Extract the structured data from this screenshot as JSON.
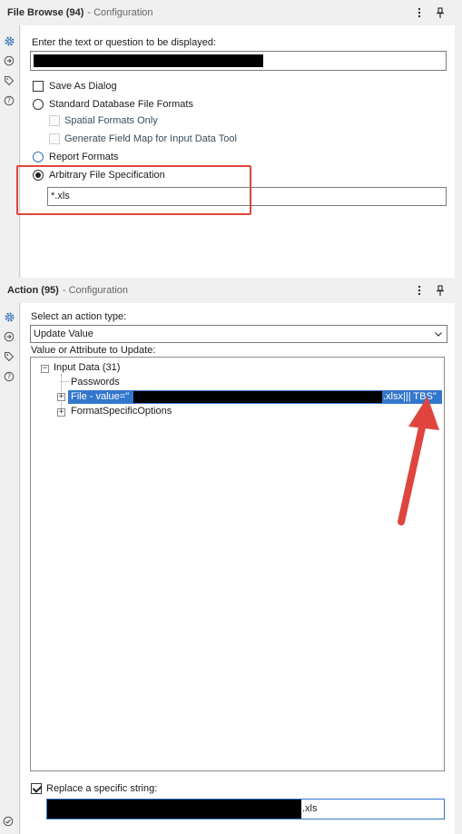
{
  "file_browse": {
    "title": "File Browse (94)",
    "subtitle": "- Configuration",
    "prompt_label": "Enter the text or question to be displayed:",
    "save_as_dialog": "Save As Dialog",
    "standard_formats": "Standard Database File Formats",
    "spatial_only": "Spatial Formats Only",
    "generate_field_map": "Generate Field Map for Input Data Tool",
    "report_formats": "Report Formats",
    "arbitrary_spec": "Arbitrary File Specification",
    "spec_value": "*.xls"
  },
  "action": {
    "title": "Action (95)",
    "subtitle": "- Configuration",
    "action_type_label": "Select an action type:",
    "action_type_value": "Update Value",
    "value_attr_label": "Value or Attribute to Update:",
    "tree": {
      "root": "Input Data (31)",
      "passwords": "Passwords",
      "file_prefix": "File - value=\"",
      "file_suffix": ".xlsx||| TBS\"",
      "format_options": "FormatSpecificOptions"
    },
    "replace_label": "Replace a specific string:",
    "replace_suffix": ".xls"
  },
  "colors": {
    "highlight_red": "#e0453d",
    "selection_blue": "#3377cc",
    "icon_blue": "#2f6fb8"
  }
}
